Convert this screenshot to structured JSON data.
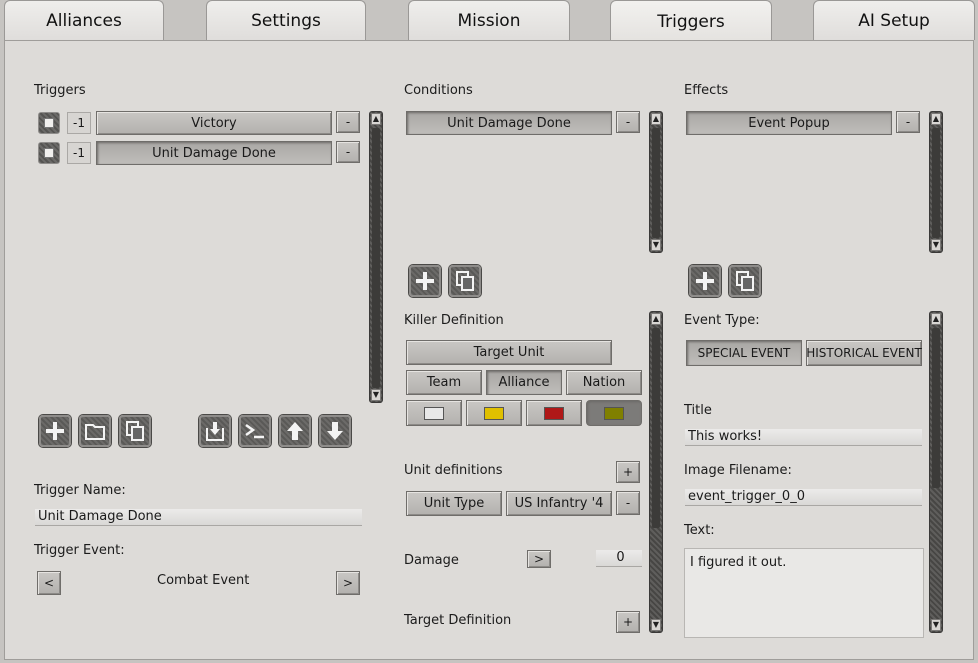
{
  "tabs": [
    {
      "label": "Alliances"
    },
    {
      "label": "Settings"
    },
    {
      "label": "Mission"
    },
    {
      "label": "Triggers",
      "active": true
    },
    {
      "label": "AI Setup"
    }
  ],
  "triggers": {
    "heading": "Triggers",
    "items": [
      {
        "index": "-1",
        "label": "Victory",
        "remove": "-"
      },
      {
        "index": "-1",
        "label": "Unit Damage Done",
        "remove": "-"
      }
    ],
    "toolbar_icons": [
      "add-icon",
      "folder-icon",
      "copy-icon",
      "import-icon",
      "console-icon",
      "arrow-up-icon",
      "arrow-down-icon"
    ],
    "name_label": "Trigger Name:",
    "name_value": "Unit Damage Done",
    "event_label": "Trigger Event:",
    "event_value": "Combat Event",
    "prev": "<",
    "next": ">"
  },
  "conditions": {
    "heading": "Conditions",
    "items": [
      {
        "label": "Unit Damage Done",
        "remove": "-"
      }
    ],
    "killer_label": "Killer Definition",
    "target_unit": "Target Unit",
    "filters": [
      "Team",
      "Alliance",
      "Nation"
    ],
    "selected_filter": "Alliance",
    "colors": [
      "#e8e8e8",
      "#e0c000",
      "#b01818",
      "#808000"
    ],
    "unit_defs_label": "Unit definitions",
    "add": "+",
    "unit_type": "Unit Type",
    "unit_value": "US Infantry '4",
    "remove": "-",
    "damage_label": "Damage",
    "damage_op": ">",
    "damage_value": "0",
    "target_def_label": "Target Definition"
  },
  "effects": {
    "heading": "Effects",
    "items": [
      {
        "label": "Event Popup",
        "remove": "-"
      }
    ],
    "event_type_label": "Event Type:",
    "event_types": [
      "SPECIAL EVENT",
      "HISTORICAL EVENT"
    ],
    "title_label": "Title",
    "title_value": "This works!",
    "image_label": "Image Filename:",
    "image_value": "event_trigger_0_0",
    "text_label": "Text:",
    "text_value": "I figured it out."
  },
  "scroll_arrows": {
    "up": "▲",
    "down": "▼"
  }
}
